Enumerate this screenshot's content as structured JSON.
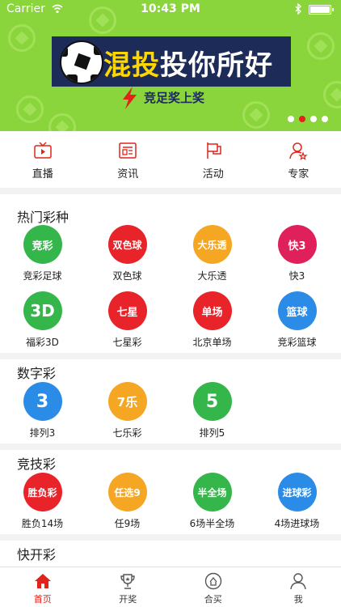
{
  "status": {
    "carrier": "Carrier",
    "time": "10:43 PM"
  },
  "banner": {
    "title_part1": "混投",
    "title_part2": "投你所好",
    "subtitle": "竞足奖上奖",
    "page_count": 4,
    "active_page": 2
  },
  "quick_nav": [
    {
      "label": "直播",
      "icon": "tv-icon"
    },
    {
      "label": "资讯",
      "icon": "news-icon"
    },
    {
      "label": "活动",
      "icon": "flag-icon"
    },
    {
      "label": "专家",
      "icon": "expert-icon"
    }
  ],
  "sections": [
    {
      "title": "热门彩种",
      "games": [
        {
          "name": "竞彩足球",
          "badge": "竞彩",
          "color": "#34b64a"
        },
        {
          "name": "双色球",
          "badge": "双色球",
          "color": "#e8232a"
        },
        {
          "name": "大乐透",
          "badge": "大乐透",
          "color": "#f5a623"
        },
        {
          "name": "快3",
          "badge": "快3",
          "color": "#e0205a"
        },
        {
          "name": "福彩3D",
          "badge": "3D",
          "color": "#34b64a"
        },
        {
          "name": "七星彩",
          "badge": "七星",
          "color": "#e8232a"
        },
        {
          "name": "北京单场",
          "badge": "单场",
          "color": "#e8232a"
        },
        {
          "name": "竞彩篮球",
          "badge": "篮球",
          "color": "#2b8ce8"
        }
      ]
    },
    {
      "title": "数字彩",
      "games": [
        {
          "name": "排列3",
          "badge": "3",
          "color": "#2b8ce8"
        },
        {
          "name": "七乐彩",
          "badge": "7乐",
          "color": "#f5a623"
        },
        {
          "name": "排列5",
          "badge": "5",
          "color": "#34b64a"
        }
      ]
    },
    {
      "title": "竞技彩",
      "games": [
        {
          "name": "胜负14场",
          "badge": "胜负彩",
          "color": "#e8232a"
        },
        {
          "name": "任9场",
          "badge": "任选9",
          "color": "#f5a623"
        },
        {
          "name": "6场半全场",
          "badge": "半全场",
          "color": "#34b64a"
        },
        {
          "name": "4场进球场",
          "badge": "进球彩",
          "color": "#2b8ce8"
        }
      ]
    },
    {
      "title": "快开彩",
      "games": []
    }
  ],
  "tabs": [
    {
      "label": "首页",
      "icon": "home-icon",
      "active": true
    },
    {
      "label": "开奖",
      "icon": "trophy-icon",
      "active": false
    },
    {
      "label": "合买",
      "icon": "group-buy-icon",
      "active": false
    },
    {
      "label": "我",
      "icon": "user-icon",
      "active": false
    }
  ],
  "colors": {
    "accent": "#e0231b",
    "banner_bg": "#8ad43c",
    "banner_box": "#1c2b57"
  }
}
